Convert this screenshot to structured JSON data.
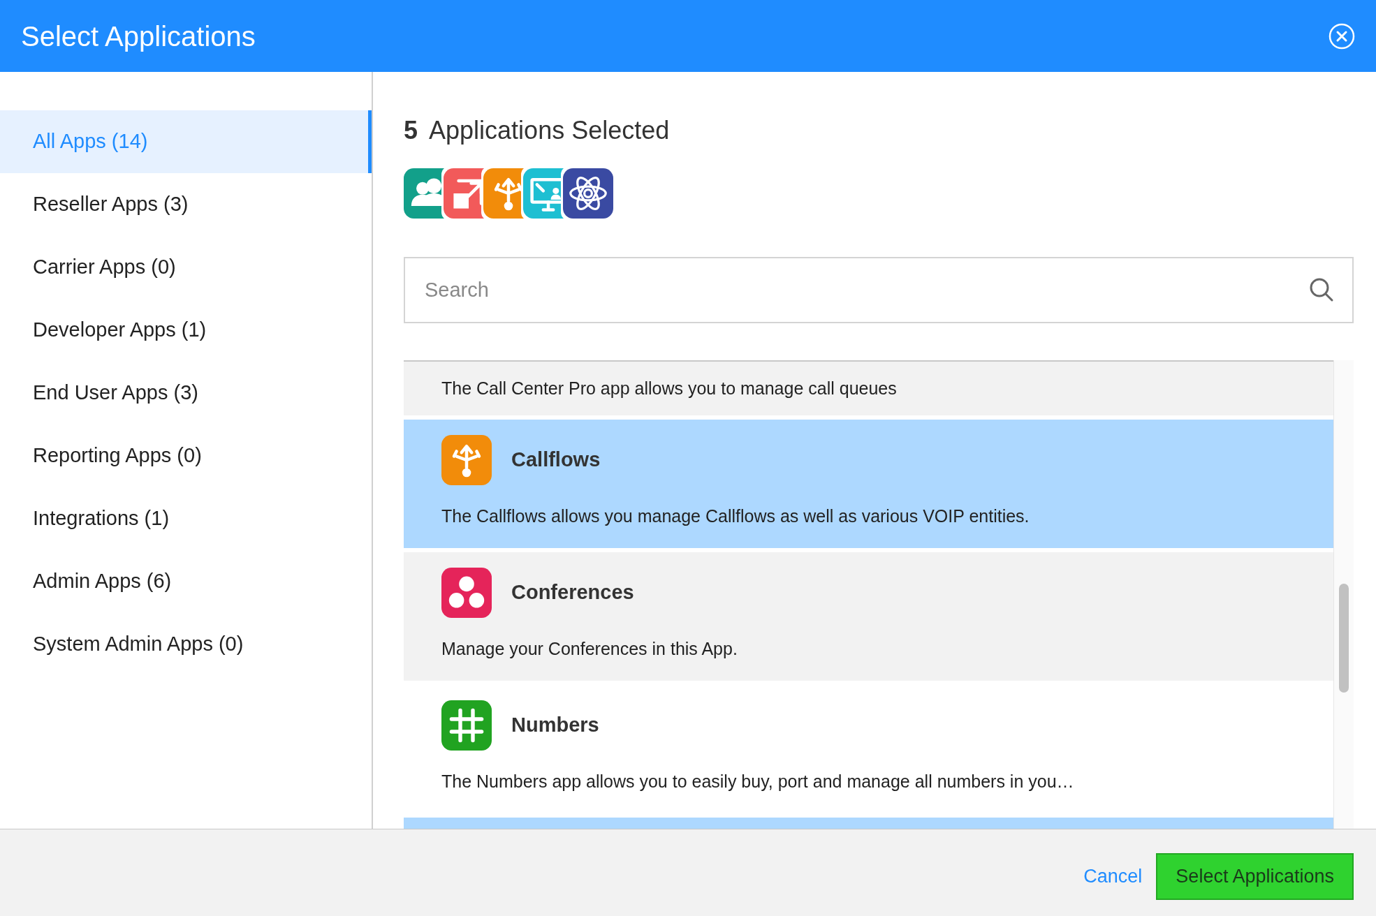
{
  "dialog": {
    "title": "Select Applications"
  },
  "sidebar": {
    "items": [
      {
        "label": "All Apps (14)",
        "selected": true
      },
      {
        "label": "Reseller Apps (3)",
        "selected": false
      },
      {
        "label": "Carrier Apps (0)",
        "selected": false
      },
      {
        "label": "Developer Apps (1)",
        "selected": false
      },
      {
        "label": "End User Apps (3)",
        "selected": false
      },
      {
        "label": "Reporting Apps (0)",
        "selected": false
      },
      {
        "label": "Integrations (1)",
        "selected": false
      },
      {
        "label": "Admin Apps (6)",
        "selected": false
      },
      {
        "label": "System Admin Apps (0)",
        "selected": false
      }
    ]
  },
  "selection": {
    "count": "5",
    "label": "Applications Selected",
    "apps": [
      {
        "kind": "users",
        "color": "#12a08a"
      },
      {
        "kind": "export",
        "color": "#f25a5a"
      },
      {
        "kind": "callflows",
        "color": "#f28c0a"
      },
      {
        "kind": "monitor",
        "color": "#1ebfd2"
      },
      {
        "kind": "atom",
        "color": "#3a4aa2"
      }
    ]
  },
  "search": {
    "placeholder": "Search"
  },
  "apps": [
    {
      "kind": "partial",
      "selected": false,
      "hovered": false,
      "description": "The Call Center Pro app allows you to manage call queues"
    },
    {
      "kind": "callflows",
      "selected": true,
      "hovered": false,
      "name": "Callflows",
      "description": "The Callflows allows you manage Callflows as well as various VOIP entities.",
      "color": "#f28c0a"
    },
    {
      "kind": "conferences",
      "selected": false,
      "hovered": false,
      "name": "Conferences",
      "description": "Manage your Conferences in this App.",
      "color": "#e5245a"
    },
    {
      "kind": "numbers",
      "selected": false,
      "hovered": true,
      "name": "Numbers",
      "description": "The Numbers app allows you to easily buy, port and manage all numbers in you…",
      "color": "#21a321"
    },
    {
      "kind": "strip",
      "selected": true,
      "hovered": false
    }
  ],
  "footer": {
    "cancel": "Cancel",
    "confirm": "Select Applications"
  }
}
